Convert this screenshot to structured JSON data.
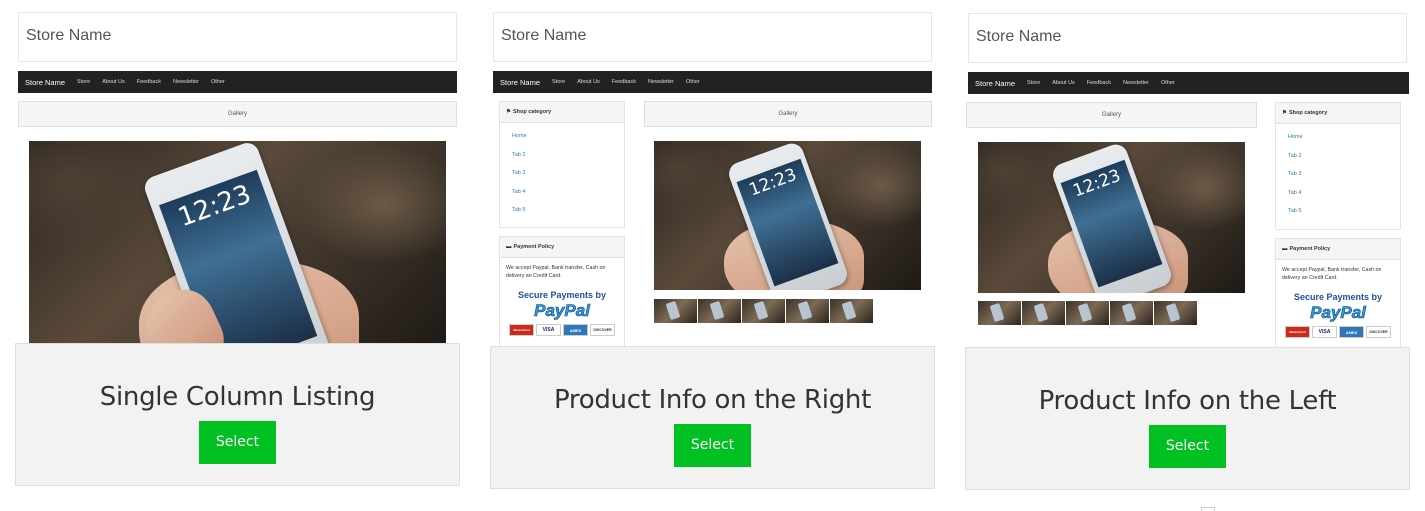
{
  "store": {
    "name": "Store Name",
    "nav": [
      "Store",
      "About Us",
      "Feedback",
      "Newsletter",
      "Other"
    ]
  },
  "gallery_label": "Gallery",
  "phone_clock": "12:23",
  "sidebar": {
    "category_title": "Shop category",
    "categories": [
      "Home",
      "Tab 2",
      "Tab 3",
      "Tab 4",
      "Tab 5"
    ],
    "policy_title": "Payment Policy",
    "policy_text": "We accept Paypal, Bank transfer, Cash on delivery an Credit Card.",
    "paypal_title": "Secure Payments by",
    "paypal_logo": "PayPal",
    "cards": [
      "MasterCard",
      "VISA",
      "AMEX",
      "DISCOVER"
    ]
  },
  "layouts": [
    {
      "title": "Single Column Listing",
      "button": "Select"
    },
    {
      "title": "Product Info on the Right",
      "button": "Select"
    },
    {
      "title": "Product Info on the Left",
      "button": "Select"
    }
  ],
  "colors": {
    "select_button": "#00c121",
    "navbar": "#222222",
    "link": "#337ab7"
  }
}
